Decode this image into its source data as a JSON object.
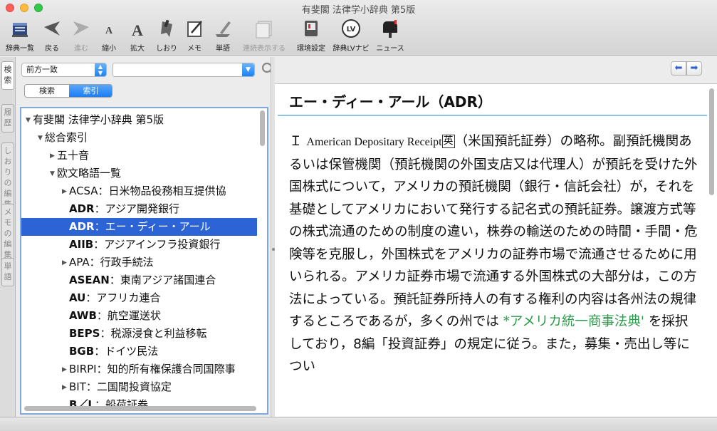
{
  "window": {
    "title": "有斐閣 法律学小辞典 第5版"
  },
  "toolbar": [
    {
      "label": "辞典一覧",
      "icon": "books-icon",
      "disabled": false
    },
    {
      "label": "戻る",
      "icon": "back-arrow-icon",
      "disabled": false
    },
    {
      "label": "進む",
      "icon": "forward-arrow-icon",
      "disabled": true
    },
    {
      "label": "縮小",
      "icon": "font-smaller-icon",
      "disabled": false
    },
    {
      "label": "拡大",
      "icon": "font-larger-icon",
      "disabled": false
    },
    {
      "label": "しおり",
      "icon": "bookmark-icon",
      "disabled": false
    },
    {
      "label": "メモ",
      "icon": "memo-icon",
      "disabled": false
    },
    {
      "label": "単語",
      "icon": "word-icon",
      "disabled": false
    },
    {
      "label": "連続表示する",
      "icon": "continuous-display-icon",
      "disabled": true
    },
    {
      "label": "環境設定",
      "icon": "preferences-icon",
      "disabled": false
    },
    {
      "label": "辞典LVナビ",
      "icon": "lv-navi-icon",
      "disabled": false
    },
    {
      "label": "ニュース",
      "icon": "mailbox-icon",
      "disabled": false
    }
  ],
  "sidetabs": [
    {
      "chars": [
        "検",
        "索"
      ],
      "active": true
    },
    {
      "chars": [
        "履",
        "歴"
      ],
      "active": false
    },
    {
      "chars": [
        "し",
        "お",
        "り",
        "の",
        "編",
        "集"
      ],
      "active": false
    },
    {
      "chars": [
        "メ",
        "モ",
        "の",
        "編",
        "集"
      ],
      "active": false
    },
    {
      "chars": [
        "単",
        "語"
      ],
      "active": false
    }
  ],
  "search": {
    "mode": "前方一致",
    "query": "",
    "segments": {
      "search": "検索",
      "index": "索引"
    }
  },
  "tree": [
    {
      "level": 0,
      "toggle": "open",
      "text": "有斐閣 法律学小辞典 第5版",
      "bold": ""
    },
    {
      "level": 1,
      "toggle": "open",
      "text": "総合索引",
      "bold": ""
    },
    {
      "level": 2,
      "toggle": "closed",
      "text": "五十音",
      "bold": ""
    },
    {
      "level": 2,
      "toggle": "open",
      "text": "欧文略語一覧",
      "bold": ""
    },
    {
      "level": 3,
      "toggle": "closed",
      "bold": "",
      "text": "ACSA：日米物品役務相互提供協"
    },
    {
      "level": 3,
      "toggle": "",
      "bold": "ADR",
      "text": "：アジア開発銀行"
    },
    {
      "level": 3,
      "toggle": "",
      "bold": "ADR",
      "text": "：エー・ディー・アール",
      "selected": true
    },
    {
      "level": 3,
      "toggle": "",
      "bold": "AIIB",
      "text": "：アジアインフラ投資銀行"
    },
    {
      "level": 3,
      "toggle": "closed",
      "bold": "",
      "text": "APA：行政手続法"
    },
    {
      "level": 3,
      "toggle": "",
      "bold": "ASEAN",
      "text": "：東南アジア諸国連合"
    },
    {
      "level": 3,
      "toggle": "",
      "bold": "AU",
      "text": "：アフリカ連合"
    },
    {
      "level": 3,
      "toggle": "",
      "bold": "AWB",
      "text": "：航空運送状"
    },
    {
      "level": 3,
      "toggle": "",
      "bold": "BEPS",
      "text": "：税源浸食と利益移転"
    },
    {
      "level": 3,
      "toggle": "",
      "bold": "BGB",
      "text": "：ドイツ民法"
    },
    {
      "level": 3,
      "toggle": "closed",
      "bold": "",
      "text": "BIRPI：知的所有権保護合同国際事"
    },
    {
      "level": 3,
      "toggle": "closed",
      "bold": "",
      "text": "BIT：二国間投資協定"
    },
    {
      "level": 3,
      "toggle": "",
      "bold": "B／L",
      "text": "：船荷証券"
    }
  ],
  "entry": {
    "title": "エー・ディー・アール（ADR）",
    "marker": "Ｉ",
    "english": "American Depositary Receipt",
    "lang_mark": "英",
    "text_1": "（米国預託証券）の略称。副預託機関あるいは保管機関（預託機関の外国支店又は代理人）が預託を受けた外国株式について，アメリカの預託機関（銀行・信託会社）が，それを基礎としてアメリカにおいて発行する記名式の預託証券。譲渡方式等の株式流通のための制度の違い，株券の輸送のための時間・手間・危険等を克服し，外国株式をアメリカの証券市場で流通させるために用いられる。アメリカ証券市場で流通する外国株式の大部分は，この方法によっている。預託証券所持人の有する権利の内容は各州法の規律するところであるが，多くの州では",
    "xref": "*アメリカ統一商事法典'",
    "text_2": "を採択しており，8編「投資証券」の規定に従う。また，募集・売出し等につい"
  }
}
